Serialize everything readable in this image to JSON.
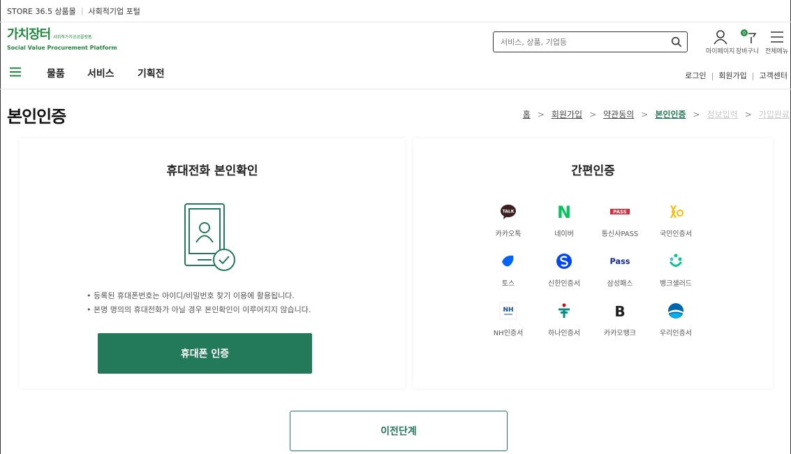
{
  "topbar": {
    "store": "STORE 36.5 상품몰",
    "portal": "사회적기업 포털"
  },
  "logo": {
    "main": "가치장터",
    "tag": "사회적가치공공플랫폼",
    "sub": "Social Value Procurement Platform"
  },
  "search": {
    "placeholder": "서비스, 상품, 기업등"
  },
  "header_icons": {
    "mypage": "마이페이지",
    "cart": "장바구니",
    "cart_count": "0",
    "menu": "전체메뉴"
  },
  "gnb": {
    "items": [
      "물품",
      "서비스",
      "기획전"
    ]
  },
  "util": {
    "login": "로그인",
    "signup": "회원가입",
    "support": "고객센터"
  },
  "page_title": "본인인증",
  "breadcrumb": {
    "home": "홈",
    "step1": "회원가입",
    "step2": "약관동의",
    "step3": "본인인증",
    "step4": "정보입력",
    "step5": "가입완료"
  },
  "phone_panel": {
    "title": "휴대전화 본인확인",
    "notes": [
      "등록된 휴대폰번호는 아이디/비밀번호 찾기 이용에 활용됩니다.",
      "본명 명의의 휴대전화가 아닐 경우 본인확인이 이루어지지 않습니다."
    ],
    "button": "휴대폰 인증"
  },
  "simple_panel": {
    "title": "간편인증",
    "providers": [
      {
        "label": "카카오톡",
        "icon": "kakaotalk-icon"
      },
      {
        "label": "네이버",
        "icon": "naver-icon"
      },
      {
        "label": "통신사PASS",
        "icon": "pass-icon"
      },
      {
        "label": "국민인증서",
        "icon": "kb-icon"
      },
      {
        "label": "토스",
        "icon": "toss-icon"
      },
      {
        "label": "신한인증서",
        "icon": "shinhan-icon"
      },
      {
        "label": "삼성패스",
        "icon": "samsung-pass-icon"
      },
      {
        "label": "뱅크샐러드",
        "icon": "banksalad-icon"
      },
      {
        "label": "NH인증서",
        "icon": "nh-icon"
      },
      {
        "label": "하나인증서",
        "icon": "hana-icon"
      },
      {
        "label": "카카오뱅크",
        "icon": "kakaobank-icon"
      },
      {
        "label": "우리인증서",
        "icon": "woori-icon"
      }
    ],
    "logo_texts": {
      "kakaotalk": "TALK",
      "naver": "N",
      "pass": "PASS",
      "samsung": "Pass",
      "nh": "NH",
      "kakaobank": "B"
    }
  },
  "prev_button": "이전단계",
  "colors": {
    "brand_green": "#1f8a3d",
    "button_green": "#237a5a"
  }
}
